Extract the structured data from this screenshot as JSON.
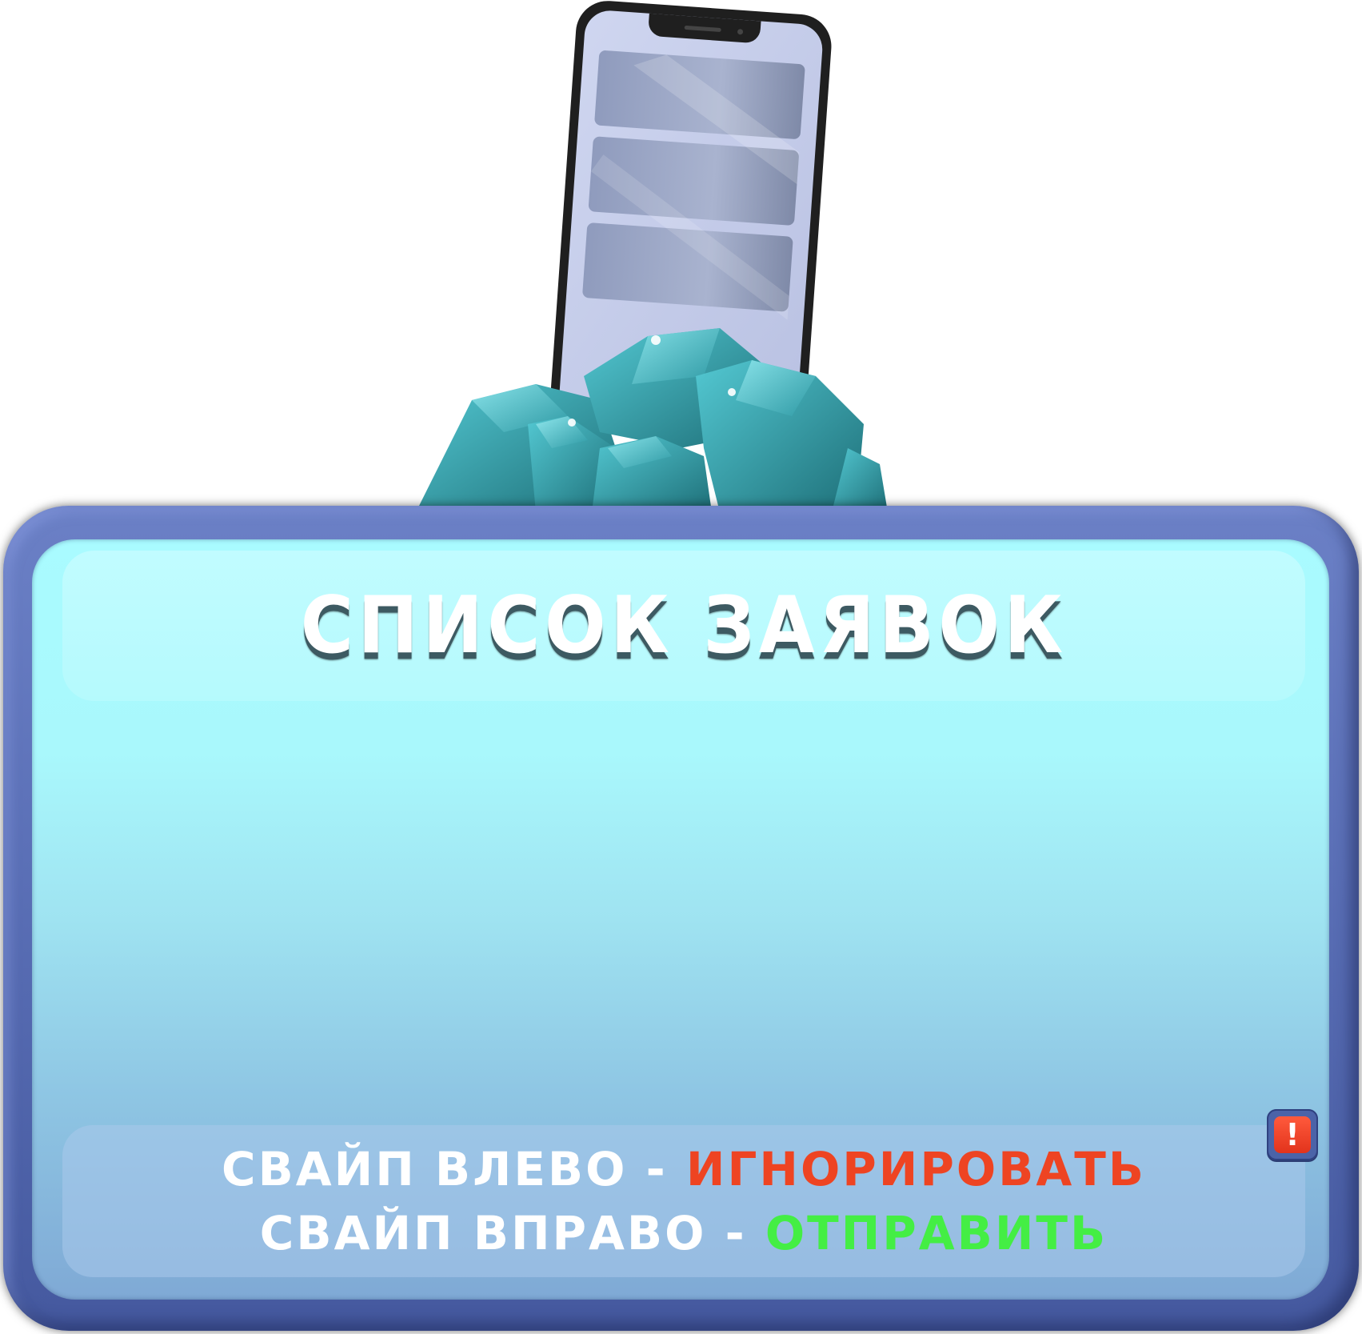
{
  "panel": {
    "title": "СПИСОК ЗАЯВОК"
  },
  "hints": {
    "left_prefix": "СВАЙП ВЛЕВО - ",
    "left_action": "ИГНОРИРОВАТЬ",
    "right_prefix": "СВАЙП ВПРАВО - ",
    "right_action": "ОТПРАВИТЬ"
  },
  "alert_button": {
    "glyph": "!"
  },
  "icons": {
    "illustration": "phone-with-gems-icon",
    "alert": "exclamation-icon"
  },
  "colors": {
    "frame": "#5a6fb6",
    "body_top": "#a9fbff",
    "body_bottom": "#7fa9d5",
    "ignore_action": "#ee4422",
    "send_action": "#44ee44",
    "alert_red": "#e2331c"
  }
}
